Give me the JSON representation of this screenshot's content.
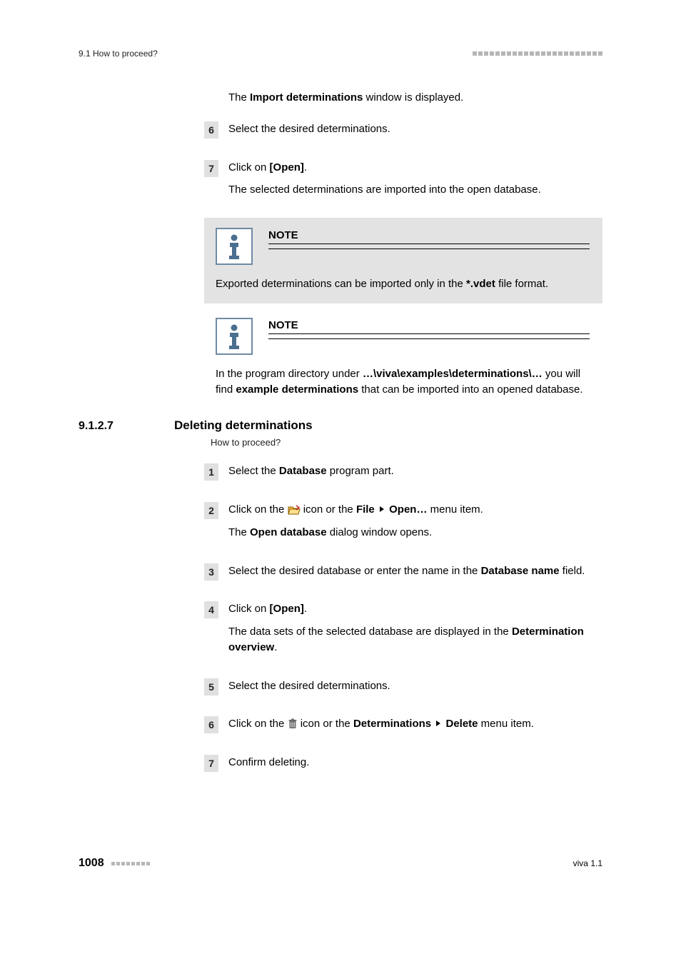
{
  "header": {
    "running": "9.1 How to proceed?"
  },
  "intro": {
    "pre": "The ",
    "bold": "Import determinations",
    "post": " window is displayed."
  },
  "stepsA": {
    "s6": {
      "num": "6",
      "text": "Select the desired determinations."
    },
    "s7": {
      "num": "7",
      "line1_pre": "Click on ",
      "line1_bold": "[Open]",
      "line1_post": ".",
      "line2": "The selected determinations are imported into the open database."
    }
  },
  "note1": {
    "title": "NOTE",
    "pre": "Exported determinations can be imported only in the ",
    "bold": "*.vdet",
    "post": " file format."
  },
  "note2": {
    "title": "NOTE",
    "pre": "In the program directory under ",
    "path": "…\\viva\\examples\\determinations\\…",
    "mid": " you will find ",
    "bold2": "example determinations",
    "post": " that can be imported into an opened database."
  },
  "section": {
    "num": "9.1.2.7",
    "title": "Deleting determinations",
    "caption": "How to proceed?"
  },
  "stepsB": {
    "s1": {
      "num": "1",
      "pre": "Select the ",
      "bold": "Database",
      "post": " program part."
    },
    "s2": {
      "num": "2",
      "pre": "Click on the ",
      "mid": " icon or the ",
      "menu1": "File",
      "menu2": "Open…",
      "post": " menu item.",
      "line2_pre": "The ",
      "line2_bold": "Open database",
      "line2_post": " dialog window opens."
    },
    "s3": {
      "num": "3",
      "pre": "Select the desired database or enter the name in the ",
      "bold": "Database name",
      "post": " field."
    },
    "s4": {
      "num": "4",
      "line1_pre": "Click on ",
      "line1_bold": "[Open]",
      "line1_post": ".",
      "line2_pre": "The data sets of the selected database are displayed in the ",
      "line2_bold": "Determination overview",
      "line2_post": "."
    },
    "s5": {
      "num": "5",
      "text": "Select the desired determinations."
    },
    "s6": {
      "num": "6",
      "pre": "Click on the ",
      "mid": " icon or the ",
      "menu1": "Determinations",
      "menu2": "Delete",
      "post": " menu item."
    },
    "s7": {
      "num": "7",
      "text": "Confirm deleting."
    }
  },
  "footer": {
    "page": "1008",
    "doc": "viva 1.1"
  }
}
